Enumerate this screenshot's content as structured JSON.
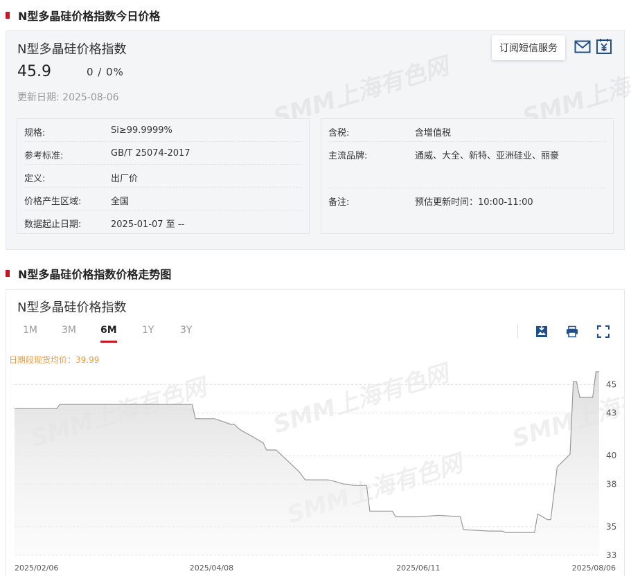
{
  "section_titles": {
    "today": "N型多晶硅价格指数今日价格",
    "trend": "N型多晶硅价格指数价格走势图"
  },
  "watermark": "SMM上海有色网",
  "info": {
    "index_name": "N型多晶硅价格指数",
    "price": "45.9",
    "change": "0 / 0%",
    "update_label": "更新日期:",
    "update_date": "2025-08-06",
    "sms_service": "订阅短信服务",
    "left_rows": [
      {
        "key": "规格:",
        "value": "Si≥99.9999%"
      },
      {
        "key": "参考标准:",
        "value": "GB/T 25074-2017"
      },
      {
        "key": "定义:",
        "value": "出厂价"
      },
      {
        "key": "价格产生区域:",
        "value": "全国"
      },
      {
        "key": "数据起止日期:",
        "value": "2025-01-07 至 --"
      }
    ],
    "right_rows": [
      {
        "key": "含税:",
        "value": "含增值税"
      },
      {
        "key": "主流品牌:",
        "value": "通威、大全、新特、亚洲硅业、丽豪"
      },
      {
        "key": "备注:",
        "value": "预估更新时间：10:00-11:00"
      }
    ]
  },
  "chart_panel": {
    "title": "N型多晶硅价格指数",
    "tabs": [
      "1M",
      "3M",
      "6M",
      "1Y",
      "3Y"
    ],
    "active_tab": "6M",
    "avg_label": "日期段现货均价：39.99"
  },
  "icons": {
    "mail": "mail-icon",
    "yen": "yen-invoice-icon",
    "download": "download-image-icon",
    "print": "print-icon",
    "fullscreen": "fullscreen-icon"
  },
  "colors": {
    "accent": "#c8161e",
    "navy": "#1f4e8c",
    "avg": "#f09a3a",
    "line": "#999999"
  },
  "chart_data": {
    "type": "area",
    "title": "",
    "xlabel": "",
    "ylabel": "",
    "ylim": [
      33,
      45.9
    ],
    "y_ticks": [
      33,
      35,
      38,
      40,
      43,
      45
    ],
    "x_ticks": [
      "2025/02/06",
      "2025/04/08",
      "2025/06/11",
      "2025/08/06"
    ],
    "grid": true,
    "series": [
      {
        "x": [
          "2025-02-06",
          "2025-02-12",
          "2025-02-19",
          "2025-02-20",
          "2025-03-05",
          "2025-03-12",
          "2025-04-02",
          "2025-04-03",
          "2025-04-09",
          "2025-04-14",
          "2025-04-15",
          "2025-04-17",
          "2025-04-21",
          "2025-04-24",
          "2025-04-25",
          "2025-04-28",
          "2025-05-05",
          "2025-05-07",
          "2025-05-14",
          "2025-05-16",
          "2025-05-19",
          "2025-05-20",
          "2025-05-22",
          "2025-05-26",
          "2025-05-27",
          "2025-06-03",
          "2025-06-04",
          "2025-06-11",
          "2025-06-17",
          "2025-06-18",
          "2025-06-24",
          "2025-06-25",
          "2025-07-03",
          "2025-07-07",
          "2025-07-08",
          "2025-07-10",
          "2025-07-14",
          "2025-07-17",
          "2025-07-18",
          "2025-07-21",
          "2025-07-22",
          "2025-07-24",
          "2025-07-28",
          "2025-07-29",
          "2025-07-30",
          "2025-07-31",
          "2025-08-04",
          "2025-08-05",
          "2025-08-06"
        ],
        "y": [
          43.3,
          43.3,
          43.3,
          43.6,
          43.6,
          43.6,
          43.6,
          42.6,
          42.6,
          42.2,
          42.2,
          41.8,
          41.3,
          40.9,
          40.4,
          40.4,
          38.9,
          38.3,
          38.3,
          38.2,
          38.0,
          38.0,
          37.9,
          37.9,
          36.1,
          36.1,
          35.7,
          35.7,
          35.8,
          35.8,
          35.7,
          34.8,
          34.7,
          34.7,
          34.6,
          34.6,
          34.6,
          34.6,
          35.9,
          35.5,
          35.5,
          39.2,
          40.1,
          45.2,
          45.2,
          44.1,
          44.1,
          45.9,
          45.9
        ]
      }
    ]
  }
}
